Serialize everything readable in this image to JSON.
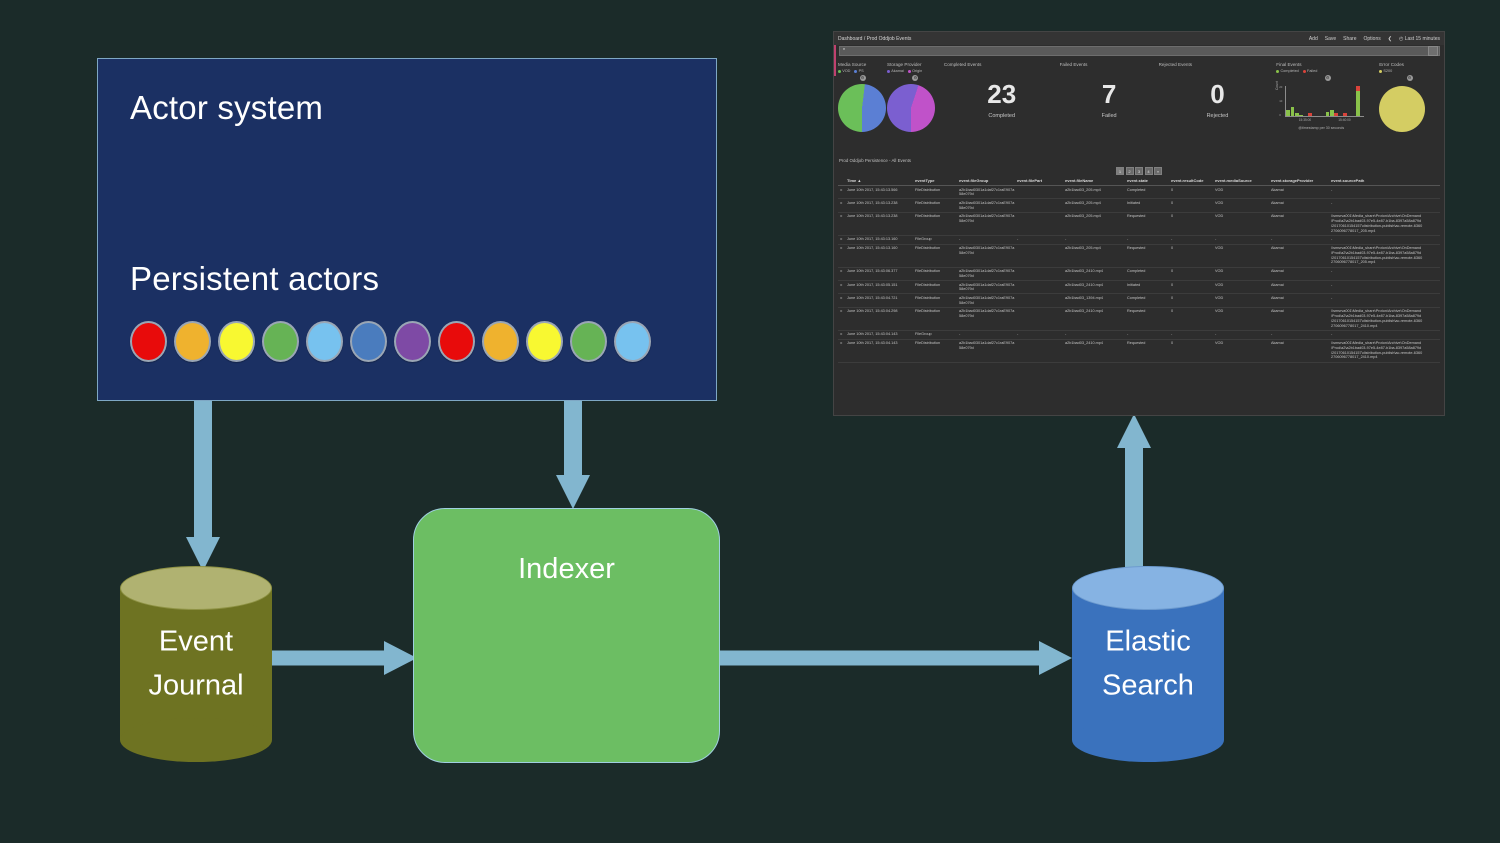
{
  "diagram": {
    "actor_system_label": "Actor system",
    "persistent_actors_label": "Persistent actors",
    "actor_colors": [
      "#e80b0b",
      "#efb22e",
      "#f8f831",
      "#66b355",
      "#77c2ef",
      "#4a7cbe",
      "#7e4aa5",
      "#e80b0b",
      "#efb22e",
      "#f8f831",
      "#66b355",
      "#77c2ef"
    ],
    "event_journal_line1": "Event",
    "event_journal_line2": "Journal",
    "indexer_label": "Indexer",
    "elastic_line1": "Elastic",
    "elastic_line2": "Search",
    "arrow_color": "#82b6cf",
    "actor_box_color": "#1b3063",
    "indexer_color": "#6cbe63",
    "journal_color": "#6e7322",
    "elastic_color": "#3a72bd"
  },
  "dashboard": {
    "breadcrumb": "Dashboard / Prod Oddjob Events",
    "topnav": [
      {
        "label": "Add"
      },
      {
        "label": "Save"
      },
      {
        "label": "Share"
      },
      {
        "label": "Options"
      },
      {
        "label": "❮"
      },
      {
        "label": "◴ Last 15 minutes"
      }
    ],
    "search": {
      "value": "*",
      "placeholder": "*",
      "submit_icon": "search-icon"
    },
    "panels": {
      "media_source": {
        "title": "Media Source",
        "legend": [
          {
            "label": "VOD",
            "color": "#6bbf59"
          },
          {
            "label": "PS",
            "color": "#5b7fd4"
          }
        ],
        "gear_icon": "gear-icon"
      },
      "storage_provider": {
        "title": "Storage Provider",
        "legend": [
          {
            "label": "Akamai",
            "color": "#7b5fd0"
          },
          {
            "label": "Origin",
            "color": "#c052c9"
          }
        ],
        "gear_icon": "gear-icon"
      },
      "completed_events": {
        "title": "Completed Events",
        "value": "23",
        "sublabel": "Completed"
      },
      "failed_events": {
        "title": "Failed Events",
        "value": "7",
        "sublabel": "Failed"
      },
      "rejected_events": {
        "title": "Rejected Events",
        "value": "0",
        "sublabel": "Rejected"
      },
      "final_events": {
        "title": "Final Events",
        "legend": [
          {
            "label": "Completed",
            "color": "#8ac24a"
          },
          {
            "label": "Failed",
            "color": "#d9433a"
          }
        ],
        "gear_icon": "gear-icon"
      },
      "error_codes": {
        "title": "Error Codes",
        "legend": [
          {
            "label": "S200",
            "color": "#d4cd63"
          }
        ],
        "gear_icon": "gear-icon"
      }
    },
    "table_title": "Prod Oddjob Persistence - All Events",
    "pager": [
      "1",
      "2",
      "3",
      "4",
      "»"
    ],
    "table": {
      "columns": [
        "Time ▲",
        "eventType",
        "event.fileGroup",
        "event.filePart",
        "event.fileName",
        "event.state",
        "event.resultCode",
        "event.mediaSource",
        "event.storageProvider",
        "event.sourcePath"
      ],
      "rows": [
        {
          "time": "June 10th 2017, 15:43:13.566",
          "eventType": "FileDistribution",
          "fileGroup": "a2b1bad0301a1daf27c1raE907a58e079d",
          "filePart": "",
          "fileName": "a2b1bad03_205.mp4",
          "state": "Completed",
          "resultCode": "0",
          "mediaSource": "VOD",
          "storageProvider": "Akamai",
          "sourcePath": "-"
        },
        {
          "time": "June 10th 2017, 15:43:13.238",
          "eventType": "FileDistribution",
          "fileGroup": "a2b1bad0301a1daf27c1raE907a58e079d",
          "filePart": "",
          "fileName": "a2b1bad03_205.mp4",
          "state": "Initiated",
          "resultCode": "0",
          "mediaSource": "VOD",
          "storageProvider": "Akamai",
          "sourcePath": "-"
        },
        {
          "time": "June 10th 2017, 15:43:13.238",
          "eventType": "FileDistribution",
          "fileGroup": "a2b1bad0301a1daf27c1raE907a58e079d",
          "filePart": "",
          "fileName": "a2b1bad03_205.mp4",
          "state": "Requested",
          "resultCode": "0",
          "mediaSource": "VOD",
          "storageProvider": "Akamai",
          "sourcePath": "\\\\smsrva001\\Media_share\\Proton\\Archive\\OnDemand\\Prod\\a2\\a2b1bad03-97e5-4e87-b1ba-8397a58a879d\\20170610154157\\distribution-publish\\ac-remote-63602706096778017_205.mp4"
        },
        {
          "time": "June 10th 2017, 15:43:13.160",
          "eventType": "FileGroup",
          "fileGroup": "-",
          "filePart": "-",
          "fileName": "-",
          "state": "-",
          "resultCode": "-",
          "mediaSource": "-",
          "storageProvider": "-",
          "sourcePath": "-"
        },
        {
          "time": "June 10th 2017, 15:43:13.160",
          "eventType": "FileDistribution",
          "fileGroup": "a2b1bad0301a1daf27c1raE907a58e079d",
          "filePart": "",
          "fileName": "a2b1bad03_205.mp4",
          "state": "Requested",
          "resultCode": "0",
          "mediaSource": "VOD",
          "storageProvider": "Akamai",
          "sourcePath": "\\\\smsrva001\\Media_share\\Proton\\Archive\\OnDemand\\Prod\\a2\\a2b1bad03-97e5-4e87-b1ba-8397a58a879d\\20170610154157\\distribution-publish\\ac-remote-63602706096778017_205.mp4"
        },
        {
          "time": "June 10th 2017, 15:43:06.377",
          "eventType": "FileDistribution",
          "fileGroup": "a2b1bad0301a1daf27c1raE907a58e079d",
          "filePart": "",
          "fileName": "a2b1bad03_2410.mp4",
          "state": "Completed",
          "resultCode": "0",
          "mediaSource": "VOD",
          "storageProvider": "Akamai",
          "sourcePath": "-"
        },
        {
          "time": "June 10th 2017, 15:43:05.151",
          "eventType": "FileDistribution",
          "fileGroup": "a2b1bad0301a1daf27c1raE907a58e079d",
          "filePart": "",
          "fileName": "a2b1bad03_2410.mp4",
          "state": "Initiated",
          "resultCode": "0",
          "mediaSource": "VOD",
          "storageProvider": "Akamai",
          "sourcePath": "-"
        },
        {
          "time": "June 10th 2017, 15:43:04.721",
          "eventType": "FileDistribution",
          "fileGroup": "a2b1bad0301a1daf27c1raE907a58e079d",
          "filePart": "",
          "fileName": "a2b1bad03_1394.mp4",
          "state": "Completed",
          "resultCode": "0",
          "mediaSource": "VOD",
          "storageProvider": "Akamai",
          "sourcePath": "-"
        },
        {
          "time": "June 10th 2017, 15:43:04.298",
          "eventType": "FileDistribution",
          "fileGroup": "a2b1bad0301a1daf27c1raE907a58e079d",
          "filePart": "",
          "fileName": "a2b1bad03_2410.mp4",
          "state": "Requested",
          "resultCode": "0",
          "mediaSource": "VOD",
          "storageProvider": "Akamai",
          "sourcePath": "\\\\smsrva001\\Media_share\\Proton\\Archive\\OnDemand\\Prod\\a2\\a2b1bad03-97e5-4e87-b1ba-8397a58a879d\\20170610154157\\distribution-publish\\ac-remote-63602706096778017_2410.mp4"
        },
        {
          "time": "June 10th 2017, 15:43:04.143",
          "eventType": "FileGroup",
          "fileGroup": "-",
          "filePart": "-",
          "fileName": "-",
          "state": "-",
          "resultCode": "-",
          "mediaSource": "-",
          "storageProvider": "-",
          "sourcePath": "-"
        },
        {
          "time": "June 10th 2017, 15:43:04.143",
          "eventType": "FileDistribution",
          "fileGroup": "a2b1bad0301a1daf27c1raE907a58e079d",
          "filePart": "",
          "fileName": "a2b1bad03_2410.mp4",
          "state": "Requested",
          "resultCode": "0",
          "mediaSource": "VOD",
          "storageProvider": "Akamai",
          "sourcePath": "\\\\smsrva001\\Media_share\\Proton\\Archive\\OnDemand\\Prod\\a2\\a2b1bad03-97e5-4e87-b1ba-8397a58a879d\\20170610154157\\distribution-publish\\ac-remote-63602706096778017_2410.mp4"
        }
      ]
    }
  },
  "chart_data": [
    {
      "type": "pie",
      "title": "Media Source",
      "labels": [
        "VOD",
        "PS"
      ],
      "values": [
        52,
        48
      ],
      "colors": [
        "#6bbf59",
        "#5b7fd4"
      ]
    },
    {
      "type": "pie",
      "title": "Storage Provider",
      "labels": [
        "Akamai",
        "Origin"
      ],
      "values": [
        55,
        45
      ],
      "colors": [
        "#7b5fd0",
        "#c052c9"
      ]
    },
    {
      "type": "bar",
      "title": "Final Events",
      "xlabel": "@timestamp per 30 seconds",
      "ylabel": "Count",
      "categories": [
        "1",
        "2",
        "3",
        "4",
        "5",
        "6",
        "7",
        "8",
        "9",
        "10",
        "11",
        "12",
        "13",
        "14",
        "15",
        "16",
        "17",
        "18"
      ],
      "tick_labels": [
        "15:35:00",
        "15:40:00"
      ],
      "ylim": [
        0,
        20
      ],
      "yticks": [
        "20",
        "10",
        "0"
      ],
      "series": [
        {
          "name": "Completed",
          "color": "#8ac24a",
          "values": [
            4,
            6,
            2,
            1,
            0,
            0,
            0,
            0,
            0,
            3,
            4,
            0,
            0,
            0,
            0,
            0,
            18,
            0
          ]
        },
        {
          "name": "Failed",
          "color": "#d9433a",
          "values": [
            0,
            0,
            0,
            0,
            0,
            2,
            0,
            0,
            0,
            0,
            0,
            2,
            0,
            2,
            0,
            0,
            4,
            0
          ]
        }
      ],
      "legend_position": "top"
    },
    {
      "type": "pie",
      "title": "Error Codes",
      "labels": [
        "S200"
      ],
      "values": [
        100
      ],
      "colors": [
        "#d4cd63"
      ]
    }
  ]
}
